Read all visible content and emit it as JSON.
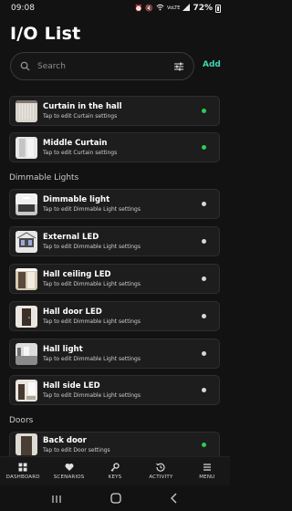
{
  "status": {
    "time": "09:08",
    "battery": "72%",
    "network": "VoLTE"
  },
  "page": {
    "title": "I/O List"
  },
  "search": {
    "placeholder": "Search"
  },
  "header": {
    "add_label": "Add"
  },
  "sections": {
    "dimmable": "Dimmable Lights",
    "doors": "Doors"
  },
  "curtains": [
    {
      "title": "Curtain in the hall",
      "subtitle": "Tap to edit Curtain settings",
      "status_color": "#2ecc52"
    },
    {
      "title": "Middle Curtain",
      "subtitle": "Tap to edit Curtain settings",
      "status_color": "#2ecc52"
    }
  ],
  "dimmable_lights": [
    {
      "title": "Dimmable light",
      "subtitle": "Tap to edit Dimmable Light settings",
      "status_color": "#d8d8d8"
    },
    {
      "title": "External LED",
      "subtitle": "Tap to edit Dimmable Light settings",
      "status_color": "#d8d8d8"
    },
    {
      "title": "Hall ceiling LED",
      "subtitle": "Tap to edit Dimmable Light settings",
      "status_color": "#d8d8d8"
    },
    {
      "title": "Hall door LED",
      "subtitle": "Tap to edit Dimmable Light settings",
      "status_color": "#d8d8d8"
    },
    {
      "title": "Hall light",
      "subtitle": "Tap to edit Dimmable Light settings",
      "status_color": "#d8d8d8"
    },
    {
      "title": "Hall side LED",
      "subtitle": "Tap to edit Dimmable Light settings",
      "status_color": "#d8d8d8"
    }
  ],
  "doors": [
    {
      "title": "Back door",
      "subtitle": "Tap to edit Door settings",
      "status_color": "#2ecc52"
    }
  ],
  "nav": [
    {
      "label": "DASHBOARD",
      "icon": "grid-icon"
    },
    {
      "label": "SCENARIOS",
      "icon": "heart-icon"
    },
    {
      "label": "KEYS",
      "icon": "key-icon"
    },
    {
      "label": "ACTIVITY",
      "icon": "history-icon"
    },
    {
      "label": "MENU",
      "icon": "menu-icon"
    }
  ],
  "colors": {
    "accent": "#3fd4b4",
    "active": "#2ecc52",
    "inactive": "#d8d8d8",
    "background": "#121212",
    "card": "#1d1d1d"
  }
}
